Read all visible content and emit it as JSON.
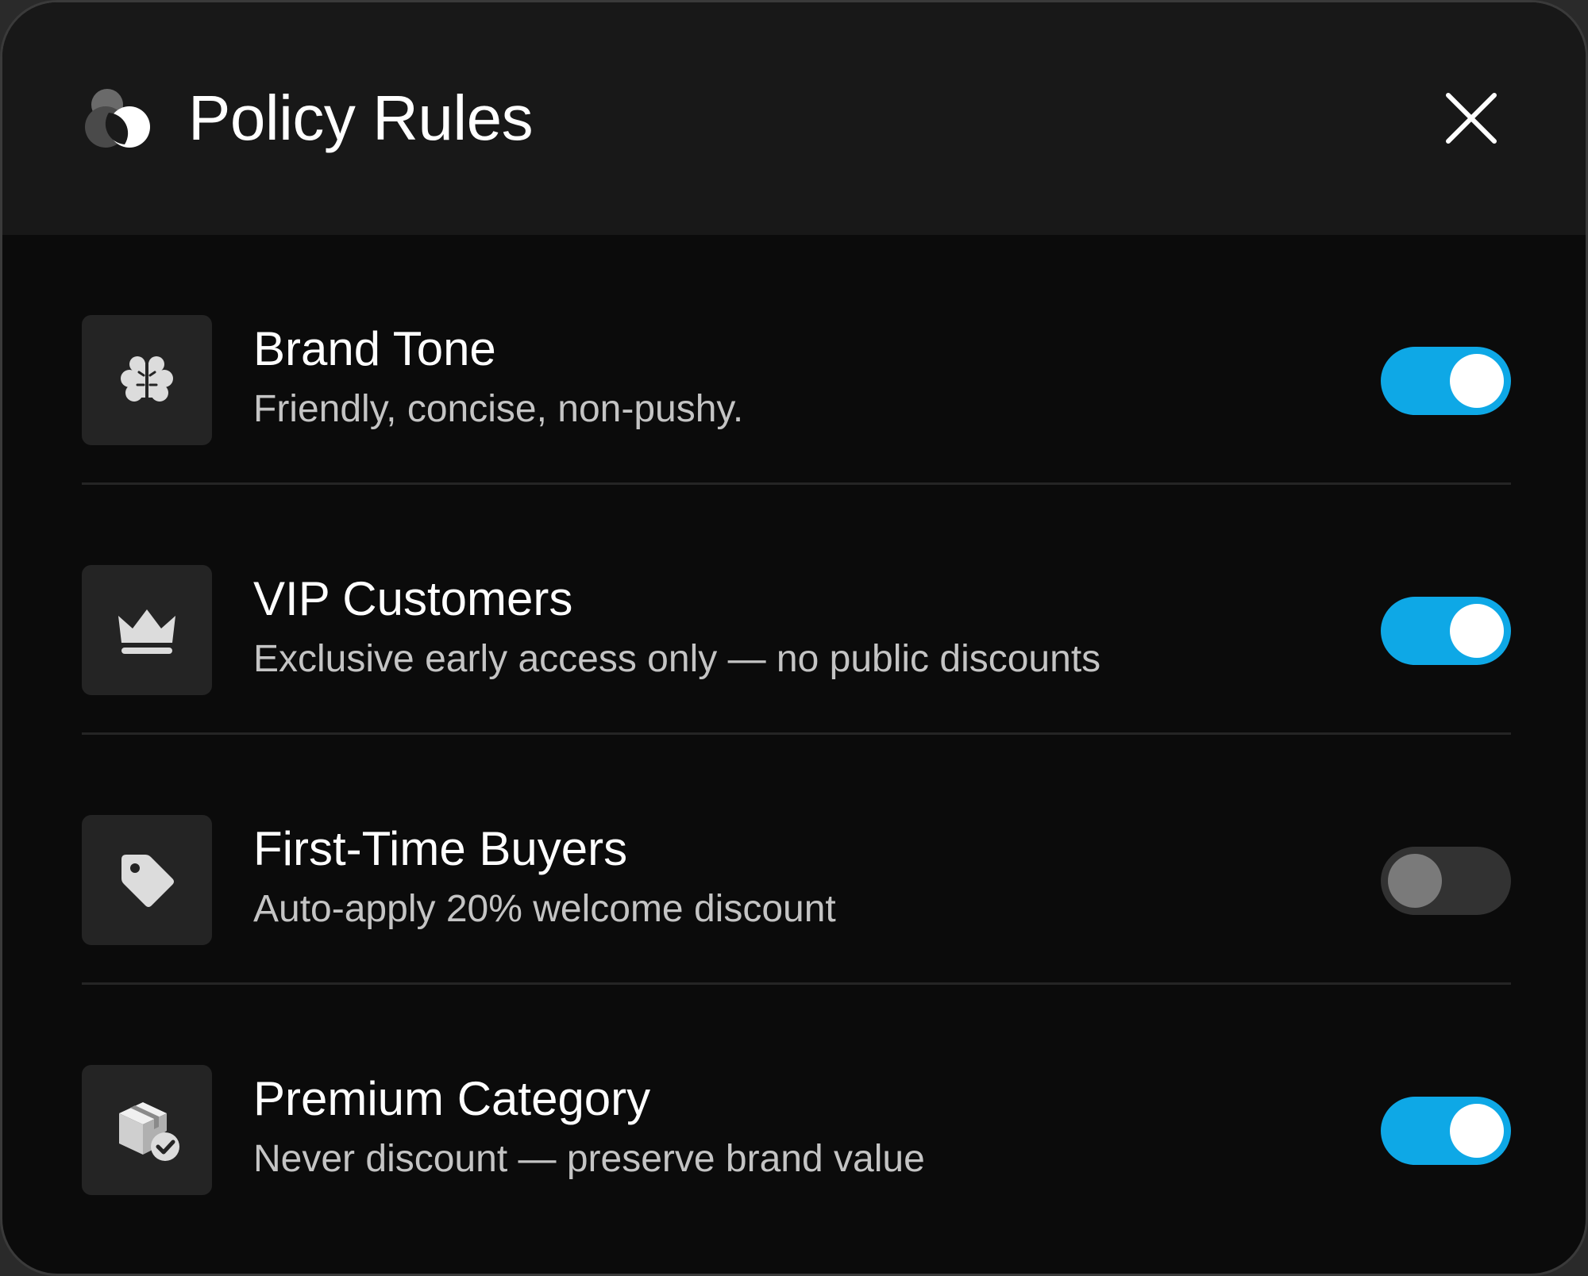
{
  "header": {
    "title": "Policy Rules",
    "logo_icon": "overlapping-circles-logo",
    "close_icon": "close-icon"
  },
  "colors": {
    "accent": "#0ea8e6",
    "background": "#0b0b0b",
    "header_background": "#181818"
  },
  "rules": [
    {
      "title": "Brand Tone",
      "description": "Friendly, concise, non-pushy.",
      "icon": "brain-icon",
      "enabled": true
    },
    {
      "title": "VIP Customers",
      "description": "Exclusive early access only — no public discounts",
      "icon": "crown-icon",
      "enabled": true
    },
    {
      "title": "First-Time Buyers",
      "description": "Auto-apply 20% welcome discount",
      "icon": "tag-icon",
      "enabled": false
    },
    {
      "title": "Premium Category",
      "description": "Never discount — preserve brand value",
      "icon": "package-check-icon",
      "enabled": true
    }
  ]
}
